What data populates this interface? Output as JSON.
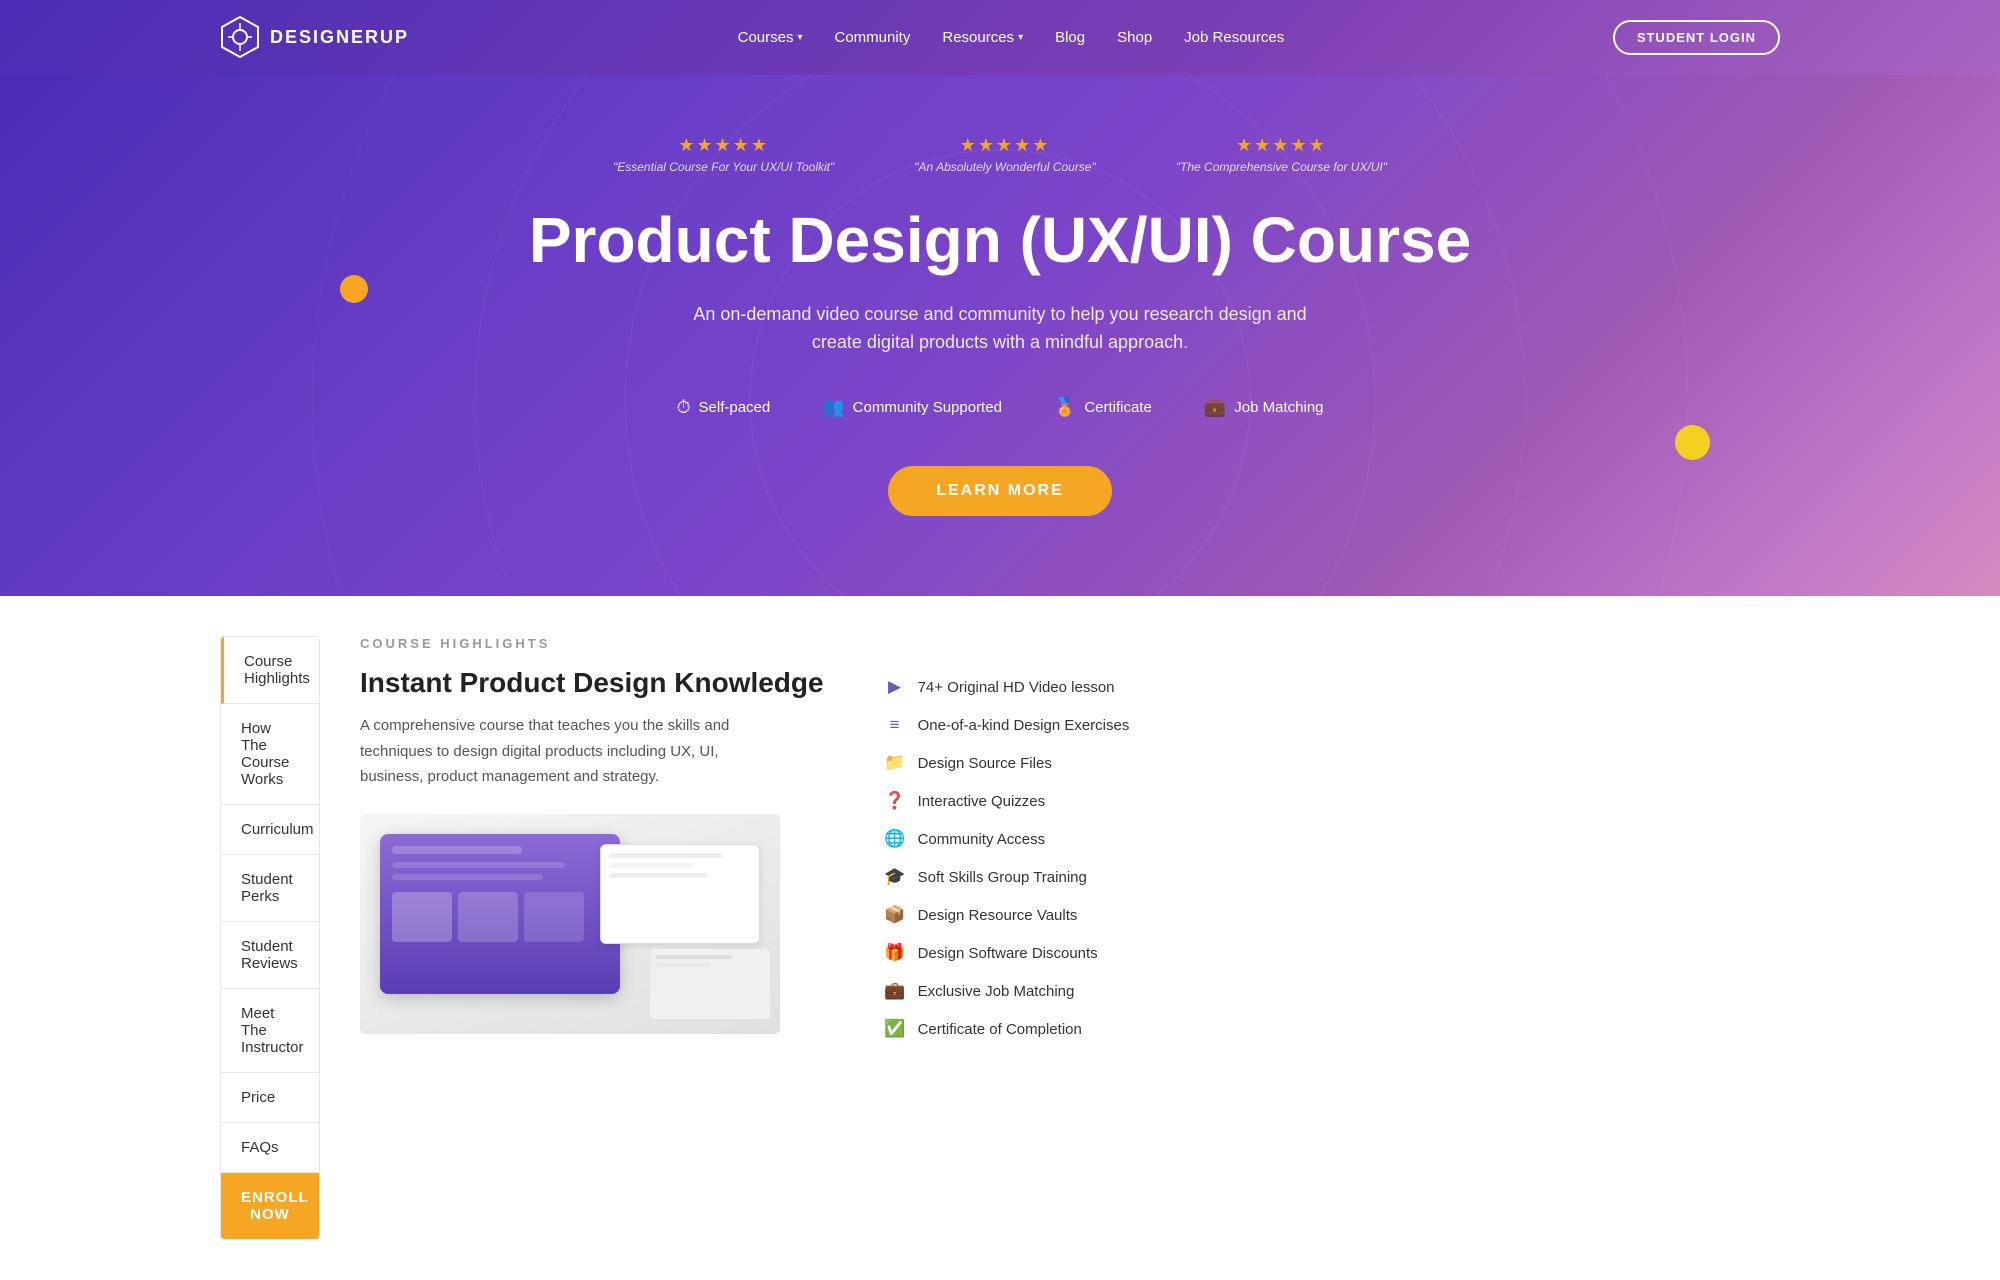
{
  "logo": {
    "text": "DESIGNERUP"
  },
  "nav": {
    "links": [
      {
        "label": "Courses",
        "hasDropdown": true
      },
      {
        "label": "Community",
        "hasDropdown": false
      },
      {
        "label": "Resources",
        "hasDropdown": true
      },
      {
        "label": "Blog",
        "hasDropdown": false
      },
      {
        "label": "Shop",
        "hasDropdown": false
      },
      {
        "label": "Job Resources",
        "hasDropdown": false
      }
    ],
    "loginButton": "STUDENT LOGIN"
  },
  "hero": {
    "starGroups": [
      {
        "quote": "\"Essential Course For Your UX/UI Toolkit\""
      },
      {
        "quote": "\"An Absolutely Wonderful Course\""
      },
      {
        "quote": "\"The Comprehensive Course for UX/UI\""
      }
    ],
    "title": "Product Design (UX/UI) Course",
    "subtitle": "An on-demand video course and community to help you research design and\ncreate digital products with a mindful approach.",
    "features": [
      {
        "icon": "⏱",
        "label": "Self-paced"
      },
      {
        "icon": "👥",
        "label": "Community Supported"
      },
      {
        "icon": "🏅",
        "label": "Certificate"
      },
      {
        "icon": "💼",
        "label": "Job Matching"
      }
    ],
    "ctaButton": "LEARN MORE"
  },
  "sidebar": {
    "menuItems": [
      {
        "label": "Course Highlights",
        "active": true
      },
      {
        "label": "How The Course Works"
      },
      {
        "label": "Curriculum"
      },
      {
        "label": "Student Perks"
      },
      {
        "label": "Student Reviews"
      },
      {
        "label": "Meet The Instructor"
      },
      {
        "label": "Price"
      },
      {
        "label": "FAQs"
      }
    ]
  },
  "courseHighlights": {
    "sectionLabel": "COURSE HIGHLIGHTS",
    "title": "Instant Product Design Knowledge",
    "description": "A comprehensive course that teaches you the skills and techniques to design digital products including UX, UI, business, product management and strategy.",
    "features": [
      {
        "icon": "▶",
        "label": "74+ Original HD Video lesson"
      },
      {
        "icon": "≡",
        "label": "One-of-a-kind Design Exercises"
      },
      {
        "icon": "📁",
        "label": "Design Source Files"
      },
      {
        "icon": "❓",
        "label": "Interactive Quizzes"
      },
      {
        "icon": "🌐",
        "label": "Community Access"
      },
      {
        "icon": "🎓",
        "label": "Soft Skills Group Training"
      },
      {
        "icon": "📦",
        "label": "Design Resource Vaults"
      },
      {
        "icon": "🎁",
        "label": "Design Software Discounts"
      },
      {
        "icon": "💼",
        "label": "Exclusive Job Matching"
      },
      {
        "icon": "✅",
        "label": "Certificate of Completion"
      }
    ]
  }
}
